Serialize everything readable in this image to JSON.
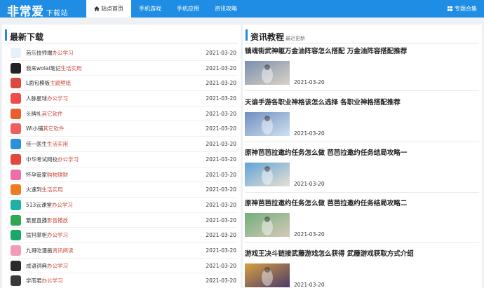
{
  "site": {
    "logo": "非常爱",
    "logo_sub": "下载站"
  },
  "nav": [
    {
      "label": "站点首页",
      "active": true,
      "icon": "home-icon"
    },
    {
      "label": "手机游戏",
      "active": false
    },
    {
      "label": "手机应用",
      "active": false
    },
    {
      "label": "资讯攻略",
      "active": false
    }
  ],
  "topic_link": {
    "label": "专题合集",
    "icon": "grid-icon"
  },
  "latest": {
    "title": "最新下载",
    "items": [
      {
        "name": "芭乐技师端",
        "cat": "办公学习",
        "date": "2021-03-20",
        "color": "#e6f0fb",
        "icon": "balejishi-app-icon"
      },
      {
        "name": "我来wolai笔记",
        "cat": "生活实用",
        "date": "2021-03-20",
        "color": "#222222",
        "icon": "wolai-app-icon"
      },
      {
        "name": "L面包模板",
        "cat": "主题壁纸",
        "date": "2021-03-20",
        "color": "#d94b3f",
        "icon": "lmianbao-app-icon"
      },
      {
        "name": "人脉星球",
        "cat": "办公学习",
        "date": "2021-03-20",
        "color": "#f04a4a",
        "icon": "renmai-app-icon"
      },
      {
        "name": "头牌礼",
        "cat": "其它软件",
        "date": "2021-03-20",
        "color": "#e8612c",
        "icon": "toupaili-app-icon"
      },
      {
        "name": "Wi小铺",
        "cat": "其它软件",
        "date": "2021-03-20",
        "color": "#f25c5c",
        "icon": "wixiaopu-app-icon"
      },
      {
        "name": "佳一医生",
        "cat": "生活实用",
        "date": "2021-03-20",
        "color": "#2d8fe0",
        "icon": "jiayi-app-icon"
      },
      {
        "name": "中华考试网校",
        "cat": "办公学习",
        "date": "2021-03-20",
        "color": "#e2483c",
        "icon": "zhonghua-app-icon"
      },
      {
        "name": "怀孕管家",
        "cat": "购物理财",
        "date": "2021-03-20",
        "color": "#ee6fa8",
        "icon": "huaiyun-app-icon"
      },
      {
        "name": "火速到",
        "cat": "生活实用",
        "date": "2021-03-20",
        "color": "#f07a22",
        "icon": "huosudao-app-icon"
      },
      {
        "name": "513云课堂",
        "cat": "办公学习",
        "date": "2021-03-20",
        "color": "#1fb0a8",
        "icon": "513-app-icon"
      },
      {
        "name": "繁星直播",
        "cat": "影音播放",
        "date": "2021-03-20",
        "color": "#2fa84f",
        "icon": "fanxing-app-icon"
      },
      {
        "name": "猛犸掌柜",
        "cat": "办公学习",
        "date": "2021-03-20",
        "color": "#1aa86a",
        "icon": "mengma-app-icon"
      },
      {
        "name": "九哥吃漫画",
        "cat": "资讯阅读",
        "date": "2021-03-20",
        "color": "#f29bb8",
        "icon": "jiuge-app-icon"
      },
      {
        "name": "成语词典",
        "cat": "办公学习",
        "date": "2021-03-20",
        "color": "#2a2a2a",
        "icon": "chengyu-app-icon"
      },
      {
        "name": "学而君",
        "cat": "办公学习",
        "date": "2021-03-20",
        "color": "#3a3a3a",
        "icon": "xueerjun-app-icon"
      }
    ]
  },
  "articles": {
    "title": "资讯教程",
    "sub": "最近更新",
    "items": [
      {
        "title": "镇魂街武神躯万金油阵容怎么搭配 万金油阵容搭配推荐",
        "date": "2021-03-20",
        "c1": "#7a8fb0",
        "c2": "#d9d2c4"
      },
      {
        "title": "天谕手游各职业神格该怎么选择 各职业神格搭配推荐",
        "date": "2021-03-20",
        "c1": "#6f8fc0",
        "c2": "#cfe0f0"
      },
      {
        "title": "原神芭芭拉邀约任务怎么做 芭芭拉邀约任务结局攻略一",
        "date": "2021-03-20",
        "c1": "#5fa3d8",
        "c2": "#e8e0d0"
      },
      {
        "title": "原神芭芭拉邀约任务怎么做 芭芭拉邀约任务结局攻略二",
        "date": "2021-03-20",
        "c1": "#6fb07a",
        "c2": "#d8c8b8"
      },
      {
        "title": "游戏王决斗链接武藤游戏怎么获得 武藤游戏获取方式介绍",
        "date": "2021-03-20",
        "c1": "#d8a040",
        "c2": "#4a3a6a"
      }
    ]
  }
}
